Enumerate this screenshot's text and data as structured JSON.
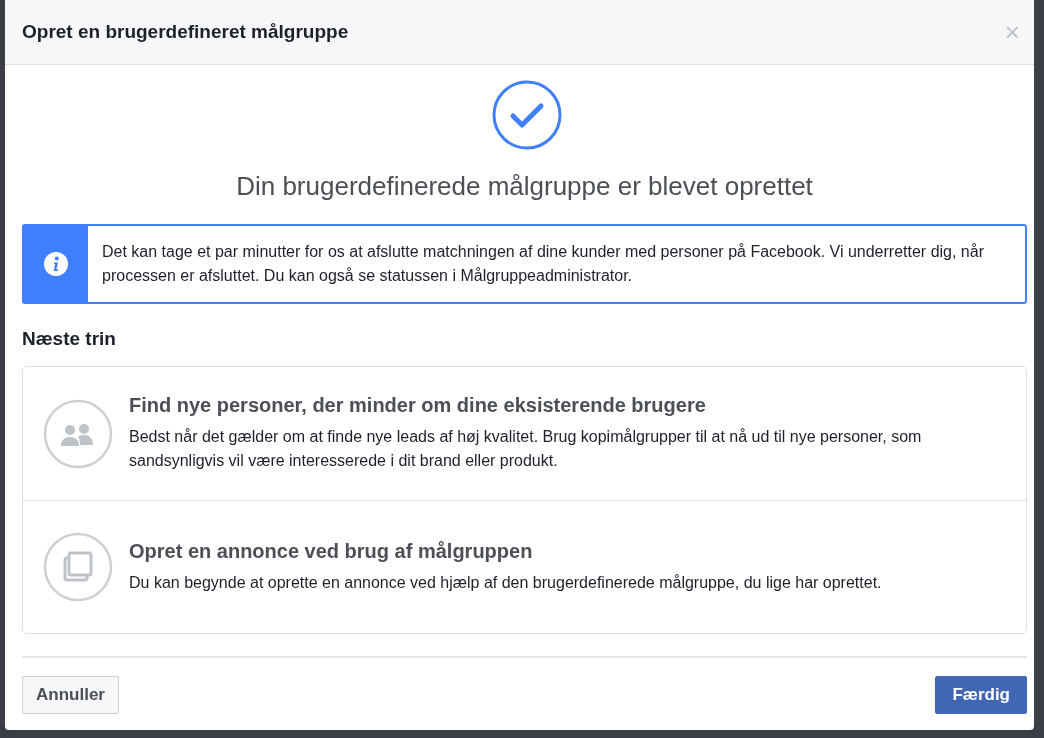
{
  "dialog": {
    "title": "Opret en brugerdefineret målgruppe",
    "close": "×"
  },
  "success": {
    "heading": "Din brugerdefinerede målgruppe er blevet oprettet"
  },
  "notice": {
    "text": "Det kan tage et par minutter for os at afslutte matchningen af dine kunder med personer på Facebook. Vi underretter dig, når processen er afsluttet. Du kan også se statussen i Målgruppeadministrator."
  },
  "next_steps": {
    "title": "Næste trin",
    "options": [
      {
        "kind": "people",
        "title": "Find nye personer, der minder om dine eksisterende brugere",
        "description": "Bedst når det gælder om at finde nye leads af høj kvalitet. Brug kopimålgrupper til at nå ud til nye personer, som sandsynligvis vil være interesserede i dit brand eller produkt."
      },
      {
        "kind": "copy",
        "title": "Opret en annonce ved brug af målgruppen",
        "description": "Du kan begynde at oprette en annonce ved hjælp af den brugerdefinerede målgruppe, du lige har oprettet."
      }
    ]
  },
  "buttons": [
    {
      "kind": "secondary",
      "label": "Annuller"
    },
    {
      "kind": "primary",
      "label": "Færdig"
    }
  ]
}
